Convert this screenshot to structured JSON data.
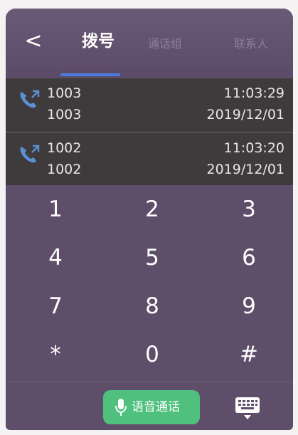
{
  "header": {
    "tabs": [
      {
        "label": "拨号",
        "active": true
      },
      {
        "label": "通话组",
        "active": false
      },
      {
        "label": "联系人",
        "active": false
      }
    ]
  },
  "call_log": [
    {
      "number": "1003",
      "name": "1003",
      "time": "11:03:29",
      "date": "2019/12/01"
    },
    {
      "number": "1002",
      "name": "1002",
      "time": "11:03:20",
      "date": "2019/12/01"
    }
  ],
  "keypad": {
    "keys": [
      "1",
      "2",
      "3",
      "4",
      "5",
      "6",
      "7",
      "8",
      "9",
      "*",
      "0",
      "#"
    ]
  },
  "bottom": {
    "voice_call_label": "语音通话"
  },
  "icons": {
    "back": "chevron-left-icon",
    "call": "phone-call-icon",
    "mic": "microphone-icon",
    "keyboard": "keyboard-icon"
  },
  "colors": {
    "background": "#5f4e69",
    "log_background": "#3f3b3c",
    "accent_underline": "#4c7be0",
    "voice_button": "#4fc07e"
  }
}
